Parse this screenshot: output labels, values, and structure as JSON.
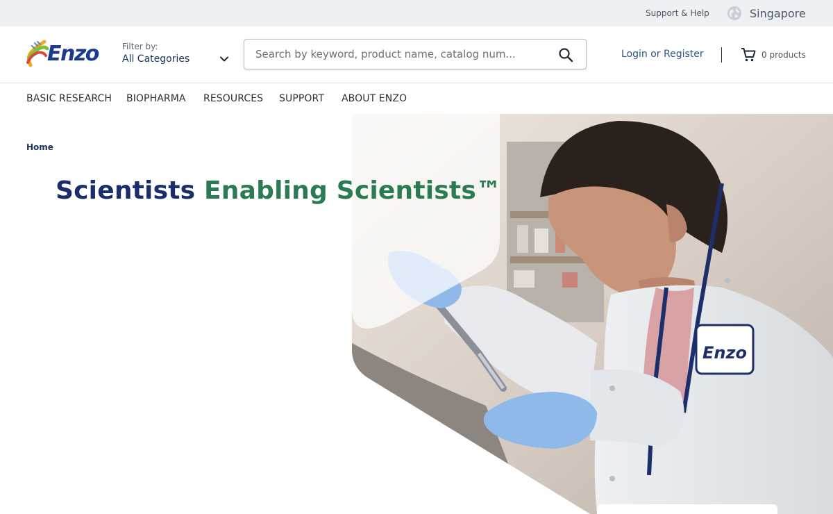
{
  "utility": {
    "support_label": "Support & Help",
    "region_label": "Singapore"
  },
  "header": {
    "logo_text": "Enzo",
    "filter_label": "Filter by:",
    "filter_value": "All Categories",
    "search_placeholder": "Search by keyword, product name, catalog num...",
    "login_label": "Login or Register",
    "cart_label": "0 products"
  },
  "nav": {
    "items": [
      {
        "label": "BASIC RESEARCH"
      },
      {
        "label": "BIOPHARMA"
      },
      {
        "label": "RESOURCES"
      },
      {
        "label": "SUPPORT"
      },
      {
        "label": "ABOUT ENZO"
      }
    ]
  },
  "hero": {
    "breadcrumb": "Home",
    "headline_part1": "Scientists",
    "headline_part2": "Enabling Scientists™",
    "badge_text": "Enzo"
  },
  "colors": {
    "brand_blue": "#1b2d6b",
    "brand_green": "#2a7a52",
    "link_blue": "#2b5587",
    "utility_bg": "#edf1f4",
    "glove_blue": "#8fb9e8"
  }
}
